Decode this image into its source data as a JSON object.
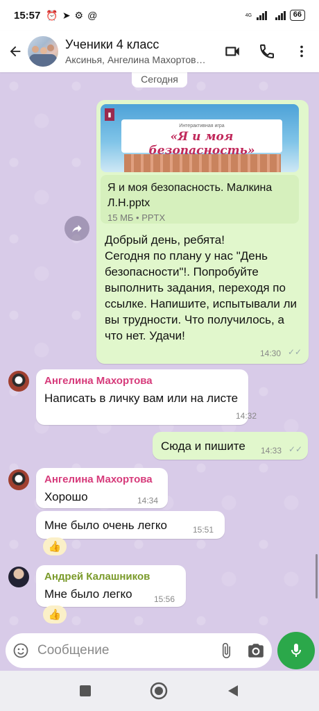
{
  "status_bar": {
    "time": "15:57",
    "network": "4G",
    "battery": "66"
  },
  "header": {
    "title": "Ученики 4 класс",
    "subtitle": "Аксинья, Ангелина Махортов…"
  },
  "day_chip": "Сегодня",
  "messages": [
    {
      "doc_title_line1": "Интерактивная игра",
      "doc_title_line2": "«Я и моя безопасность»",
      "file_name": "Я и моя безопасность. Малкина Л.Н.pptx",
      "file_meta": "15 МБ • PPTX",
      "text": "Добрый день, ребята!\nСегодня по плану у нас \"День безопасности\"!. Попробуйте выполнить задания, переходя по ссылке. Напишите, испытывали ли вы трудности. Что получилось, а что нет. Удачи!",
      "time": "14:30"
    },
    {
      "sender": "Ангелина Махортова",
      "text": "Написать в личку вам или на листе",
      "time": "14:32"
    },
    {
      "text": "Сюда и пишите",
      "time": "14:33"
    },
    {
      "sender": "Ангелина Махортова",
      "text": "Хорошо",
      "time": "14:34"
    },
    {
      "text": "Мне было очень легко",
      "time": "15:51",
      "reaction": "👍"
    },
    {
      "sender": "Андрей Калашников",
      "text": "Мне было легко",
      "time": "15:56",
      "reaction": "👍"
    }
  ],
  "compose": {
    "placeholder": "Сообщение"
  },
  "colors": {
    "accent_green": "#2ba84a",
    "sender_pink": "#d63a7a",
    "sender_olive": "#7a9a2a",
    "outgoing_bubble": "#e1f7cc",
    "chat_background": "#d8cbe8"
  },
  "icons": {
    "back": "arrow-left-icon",
    "video": "video-camera-icon",
    "call": "phone-icon",
    "menu": "more-vert-icon",
    "forward": "forward-icon",
    "emoji": "emoji-icon",
    "attach": "paperclip-icon",
    "camera": "camera-icon",
    "mic": "mic-icon"
  }
}
